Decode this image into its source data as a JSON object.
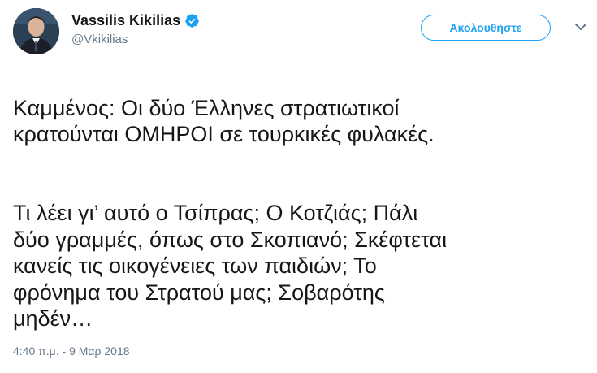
{
  "author": {
    "display_name": "Vassilis Kikilias",
    "handle": "@Vkikilias",
    "verified": true
  },
  "actions": {
    "follow_label": "Ακολουθήστε",
    "more_icon": "chevron-down-icon"
  },
  "tweet": {
    "paragraph_1": "Καμμένος: Οι δύο Έλληνες στρατιωτικοί\nκρατούνται ΟΜΗΡΟΙ σε τουρκικές φυλακές.",
    "paragraph_2": "Τι λέει γι’ αυτό ο Τσίπρας; Ο Κοτζιάς; Πάλι\nδύο γραμμές, όπως στο Σκοπιανό; Σκέφτεται\nκανείς τις οικογένειες των παιδιών; Το\nφρόνημα του Στρατού μας; Σοβαρότης\nμηδέν…",
    "timestamp": "4:40 π.μ. - 9 Μαρ 2018"
  },
  "colors": {
    "accent": "#1da1f2",
    "text": "#14171a",
    "secondary": "#657786"
  }
}
